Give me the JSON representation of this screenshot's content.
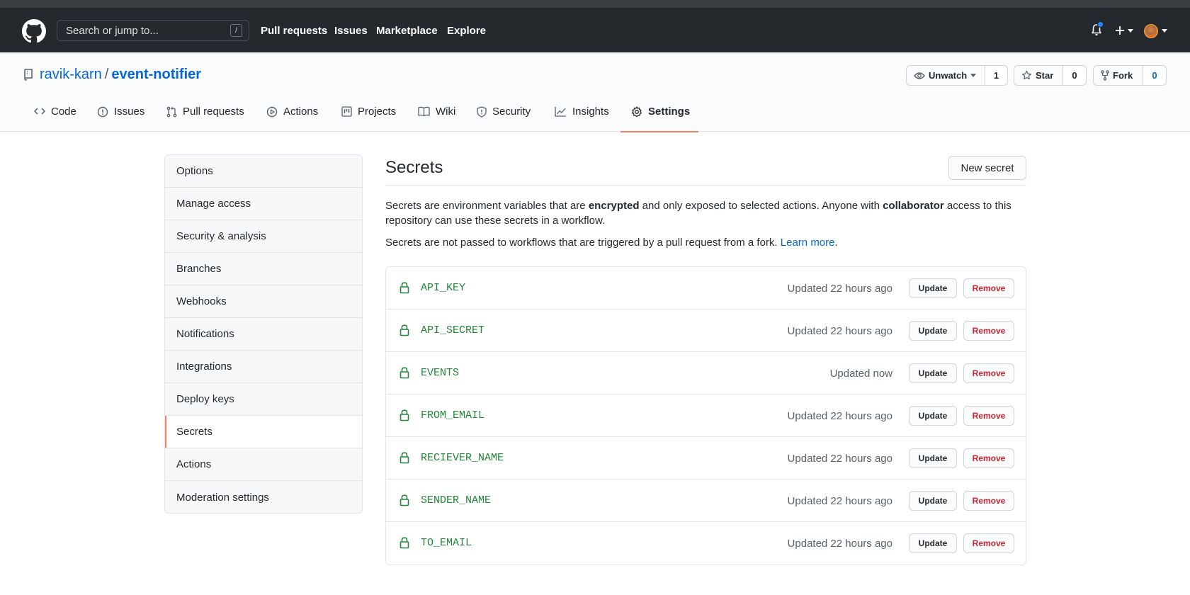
{
  "header": {
    "search_placeholder": "Search or jump to...",
    "slash_key": "/",
    "nav": [
      "Pull requests",
      "Issues",
      "Marketplace",
      "Explore"
    ],
    "colors": {
      "background": "#24292e",
      "notification_dot": "#2188ff"
    }
  },
  "repo": {
    "owner": "ravik-karn",
    "separator": "/",
    "name": "event-notifier",
    "watch_label": "Unwatch",
    "watch_count": "1",
    "star_label": "Star",
    "star_count": "0",
    "fork_label": "Fork",
    "fork_count": "0"
  },
  "tabs": [
    {
      "label": "Code",
      "icon": "code-icon"
    },
    {
      "label": "Issues",
      "icon": "issue-icon"
    },
    {
      "label": "Pull requests",
      "icon": "pull-request-icon"
    },
    {
      "label": "Actions",
      "icon": "play-icon"
    },
    {
      "label": "Projects",
      "icon": "project-icon"
    },
    {
      "label": "Wiki",
      "icon": "book-icon"
    },
    {
      "label": "Security",
      "icon": "shield-icon"
    },
    {
      "label": "Insights",
      "icon": "graph-icon"
    },
    {
      "label": "Settings",
      "icon": "gear-icon",
      "selected": true
    }
  ],
  "sidebar": {
    "items": [
      {
        "label": "Options"
      },
      {
        "label": "Manage access"
      },
      {
        "label": "Security & analysis"
      },
      {
        "label": "Branches"
      },
      {
        "label": "Webhooks"
      },
      {
        "label": "Notifications"
      },
      {
        "label": "Integrations"
      },
      {
        "label": "Deploy keys"
      },
      {
        "label": "Secrets",
        "selected": true
      },
      {
        "label": "Actions"
      },
      {
        "label": "Moderation settings"
      }
    ]
  },
  "main": {
    "title": "Secrets",
    "new_secret_label": "New secret",
    "desc1": {
      "a": "Secrets are environment variables that are ",
      "b": "encrypted",
      "c": " and only exposed to selected actions. Anyone with ",
      "d": "collaborator",
      "e": " access to this repository can use these secrets in a workflow."
    },
    "desc2": {
      "a": "Secrets are not passed to workflows that are triggered by a pull request from a fork. ",
      "link": "Learn more",
      "b": "."
    },
    "update_label": "Update",
    "remove_label": "Remove",
    "secrets": [
      {
        "name": "API_KEY",
        "updated": "Updated 22 hours ago"
      },
      {
        "name": "API_SECRET",
        "updated": "Updated 22 hours ago"
      },
      {
        "name": "EVENTS",
        "updated": "Updated now"
      },
      {
        "name": "FROM_EMAIL",
        "updated": "Updated 22 hours ago"
      },
      {
        "name": "RECIEVER_NAME",
        "updated": "Updated 22 hours ago"
      },
      {
        "name": "SENDER_NAME",
        "updated": "Updated 22 hours ago"
      },
      {
        "name": "TO_EMAIL",
        "updated": "Updated 22 hours ago"
      }
    ],
    "colors": {
      "secret_name": "#22863a",
      "remove_text": "#cb2431",
      "link": "#0366d6",
      "accent": "#f9826c"
    }
  }
}
